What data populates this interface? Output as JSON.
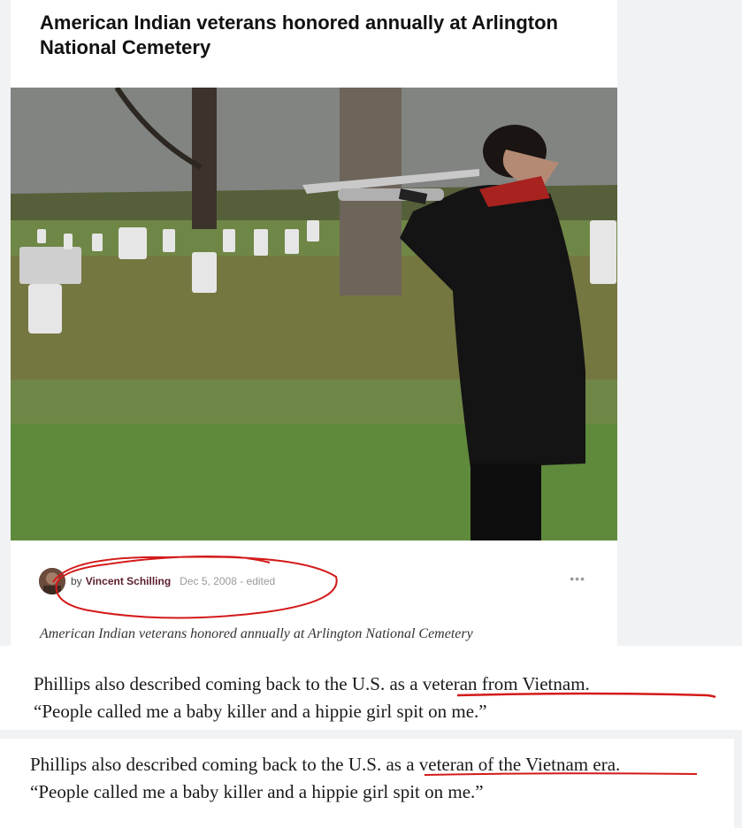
{
  "article": {
    "headline": "American Indian veterans honored annually at Arlington National Cemetery",
    "byline": {
      "by": "by",
      "author": "Vincent Schilling",
      "date": "Dec 5, 2008 - edited",
      "more": "•••"
    },
    "caption": "American Indian veterans honored annually at Arlington National Cemetery"
  },
  "quote_1": {
    "line1_prefix": "Phillips also described coming back to the U.S. ",
    "line1_highlight": "as a veteran from Vietnam.",
    "line2": "“People called me a baby killer and a hippie girl spit on me.”"
  },
  "quote_2": {
    "line1_prefix": "Phillips also described coming back to the U.S. ",
    "line1_highlight": "as a veteran of the Vietnam era.",
    "line2": "“People called me a baby killer and a hippie girl spit on me.”"
  },
  "colors": {
    "annotation_red": "#d41a1a",
    "author": "#5a1e2a"
  }
}
